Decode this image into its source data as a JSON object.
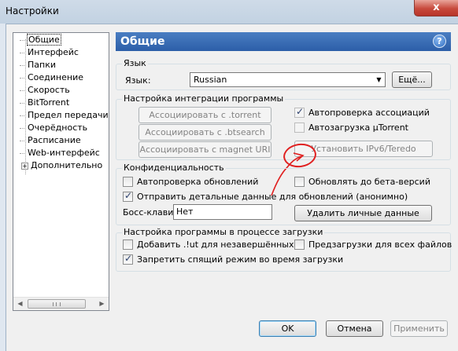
{
  "window": {
    "title": "Настройки",
    "close_glyph": "x"
  },
  "sidebar": {
    "items": [
      {
        "label": "Общие",
        "selected": true
      },
      {
        "label": "Интерфейс"
      },
      {
        "label": "Папки"
      },
      {
        "label": "Соединение"
      },
      {
        "label": "Скорость"
      },
      {
        "label": "BitTorrent"
      },
      {
        "label": "Предел передачи"
      },
      {
        "label": "Очерёдность"
      },
      {
        "label": "Расписание"
      },
      {
        "label": "Web-интерфейс"
      },
      {
        "label": "Дополнительно",
        "expandable": true
      }
    ],
    "expander_glyph": "+"
  },
  "header": {
    "title": "Общие",
    "help_glyph": "?"
  },
  "language": {
    "group_title": "Язык",
    "label": "Язык:",
    "selected": "Russian",
    "more_button": "Ещё..."
  },
  "integration": {
    "group_title": "Настройка интеграции программы",
    "assoc_torrent": "Ассоциировать с .torrent",
    "assoc_btsearch": "Ассоциировать с .btsearch",
    "assoc_magnet": "Ассоциировать с magnet URI",
    "auto_check_assoc": {
      "label": "Автопроверка ассоциаций",
      "checked": true
    },
    "autostart": {
      "label": "Автозагрузка µTorrent",
      "checked": false
    },
    "ipv6_button": "Установить IPv6/Teredo"
  },
  "privacy": {
    "group_title": "Конфиденциальность",
    "auto_check_updates": {
      "label": "Автопроверка обновлений",
      "checked": false
    },
    "beta_updates": {
      "label": "Обновлять до бета-версий",
      "checked": false
    },
    "send_details": {
      "label": "Отправить детальные данные для обновлений (анонимно)",
      "checked": true
    },
    "boss_key_label": "Босс-клавиша",
    "boss_key_value": "Нет",
    "clear_private_button": "Удалить личные данные"
  },
  "download": {
    "group_title": "Настройка программы в процессе загрузки",
    "append_ut": {
      "label": "Добавить .!ut для незавершённых",
      "checked": false
    },
    "prealloc": {
      "label": "Предзагрузки для всех файлов",
      "checked": false
    },
    "prevent_standby": {
      "label": "Запретить спящий режим во время загрузки",
      "checked": true
    }
  },
  "footer": {
    "ok": "OK",
    "cancel": "Отмена",
    "apply": "Применить"
  },
  "colors": {
    "header_bg": "#3a6fb8",
    "annotation": "#e02020"
  }
}
